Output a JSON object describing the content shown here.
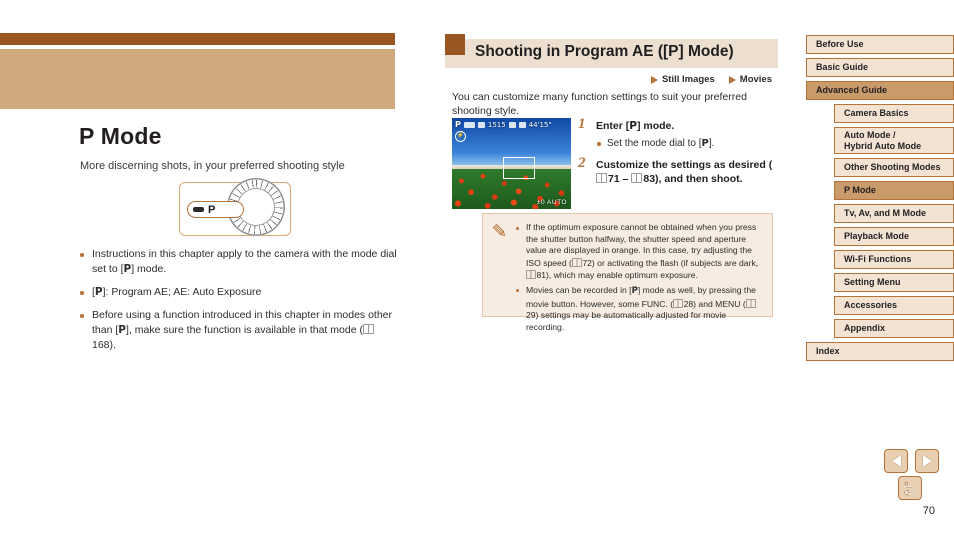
{
  "left_page": {
    "title": "P Mode",
    "subtitle": "More discerning shots, in your preferred shooting style",
    "dial_figure": {
      "callout_label": "P",
      "icon": "mode-dial-icon"
    },
    "bullets": [
      {
        "parts": [
          {
            "t": "text",
            "v": "Instructions in this chapter apply to the camera with the mode dial set to ["
          },
          {
            "t": "bold",
            "v": "P"
          },
          {
            "t": "text",
            "v": "] mode."
          }
        ]
      },
      {
        "parts": [
          {
            "t": "text",
            "v": "["
          },
          {
            "t": "bold",
            "v": "P"
          },
          {
            "t": "text",
            "v": "]: Program AE; AE: Auto Exposure"
          }
        ]
      },
      {
        "parts": [
          {
            "t": "text",
            "v": "Before using a function introduced in this chapter in modes other than ["
          },
          {
            "t": "bold",
            "v": "P"
          },
          {
            "t": "text",
            "v": "], make sure the function is available in that mode ("
          },
          {
            "t": "bookref",
            "v": ""
          },
          {
            "t": "text",
            "v": "168)."
          }
        ]
      }
    ]
  },
  "middle_column": {
    "section_title": "Shooting in Program AE ([P] Mode)",
    "media_tags": [
      {
        "label": "Still Images",
        "icon": "triangle-marker-icon"
      },
      {
        "label": "Movies",
        "icon": "triangle-marker-icon"
      }
    ],
    "intro": "You can customize many function settings to suit your preferred shooting style.",
    "lcd_screenshot": {
      "icon": "camera-lcd-preview",
      "mode_indicator": "P",
      "shots_remaining": "1515",
      "time_remaining": "44'15\"",
      "bottom_info": "±0  AUTO",
      "flash_icon": "flash-off-icon"
    },
    "steps": [
      {
        "number": "1",
        "title_parts": [
          {
            "t": "text",
            "v": "Enter ["
          },
          {
            "t": "bold",
            "v": "P"
          },
          {
            "t": "text",
            "v": "] mode."
          }
        ],
        "sub_parts": [
          {
            "t": "text",
            "v": "Set the mode dial to ["
          },
          {
            "t": "bold",
            "v": "P"
          },
          {
            "t": "text",
            "v": "]."
          }
        ]
      },
      {
        "number": "2",
        "title_parts": [
          {
            "t": "text",
            "v": "Customize the settings as desired ("
          },
          {
            "t": "bookref",
            "v": ""
          },
          {
            "t": "text",
            "v": "71 – "
          },
          {
            "t": "bookref",
            "v": ""
          },
          {
            "t": "text",
            "v": "83), and then shoot."
          }
        ],
        "sub_parts": []
      }
    ],
    "note_box": {
      "icon": "pencil-note-icon",
      "bullets": [
        {
          "parts": [
            {
              "t": "text",
              "v": "If the optimum exposure cannot be obtained when you press the shutter button halfway, the shutter speed and aperture value are displayed in orange. In this case, try adjusting the ISO speed ("
            },
            {
              "t": "bookref",
              "v": ""
            },
            {
              "t": "text",
              "v": "72) or activating the flash (if subjects are dark, "
            },
            {
              "t": "bookref",
              "v": ""
            },
            {
              "t": "text",
              "v": "81), which may enable optimum exposure."
            }
          ]
        },
        {
          "parts": [
            {
              "t": "text",
              "v": "Movies can be recorded in ["
            },
            {
              "t": "bold",
              "v": "P"
            },
            {
              "t": "text",
              "v": "] mode as well, by pressing the movie button. However, some FUNC. ("
            },
            {
              "t": "bookref",
              "v": ""
            },
            {
              "t": "text",
              "v": "28) and MENU ("
            },
            {
              "t": "bookref",
              "v": ""
            },
            {
              "t": "text",
              "v": "29) settings may be automatically adjusted for movie recording."
            }
          ]
        }
      ]
    }
  },
  "sidebar": {
    "items": [
      {
        "label": "Before Use",
        "level": "top",
        "active": false,
        "tall": false
      },
      {
        "label": "Basic Guide",
        "level": "top",
        "active": false,
        "tall": false
      },
      {
        "label": "Advanced Guide",
        "level": "top",
        "active": true,
        "tall": false
      },
      {
        "label": "Camera Basics",
        "level": "sub",
        "active": false,
        "tall": false
      },
      {
        "label": "Auto Mode /\nHybrid Auto Mode",
        "level": "sub",
        "active": false,
        "tall": true
      },
      {
        "label": "Other Shooting Modes",
        "level": "sub",
        "active": false,
        "tall": false
      },
      {
        "label": "P Mode",
        "level": "sub",
        "active": true,
        "tall": false
      },
      {
        "label": "Tv, Av, and M Mode",
        "level": "sub",
        "active": false,
        "tall": false
      },
      {
        "label": "Playback Mode",
        "level": "sub",
        "active": false,
        "tall": false
      },
      {
        "label": "Wi-Fi Functions",
        "level": "sub",
        "active": false,
        "tall": false
      },
      {
        "label": "Setting Menu",
        "level": "sub",
        "active": false,
        "tall": false
      },
      {
        "label": "Accessories",
        "level": "sub",
        "active": false,
        "tall": false
      },
      {
        "label": "Appendix",
        "level": "sub",
        "active": false,
        "tall": false
      },
      {
        "label": "Index",
        "level": "top",
        "active": false,
        "tall": false
      }
    ]
  },
  "footer": {
    "prev_icon": "arrow-left-icon",
    "next_icon": "arrow-right-icon",
    "home_icon": "return-home-icon",
    "page_number": "70"
  },
  "colors": {
    "accent_dark": "#9a5621",
    "accent_band": "#cfa87d",
    "accent_border": "#b5733a",
    "nav_light": "#f2e3d3",
    "nav_active": "#c99b6b",
    "note_bg": "#f6ece1",
    "header_bg": "#eddfcf"
  }
}
